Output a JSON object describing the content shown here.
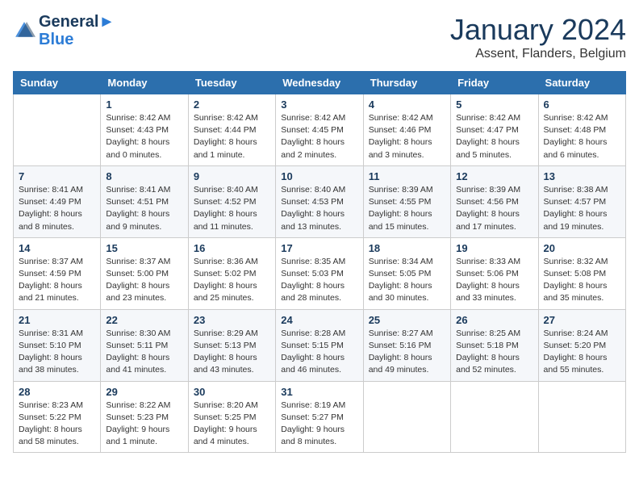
{
  "header": {
    "logo_line1": "General",
    "logo_line2": "Blue",
    "month": "January 2024",
    "location": "Assent, Flanders, Belgium"
  },
  "weekdays": [
    "Sunday",
    "Monday",
    "Tuesday",
    "Wednesday",
    "Thursday",
    "Friday",
    "Saturday"
  ],
  "weeks": [
    [
      {
        "day": "",
        "info": ""
      },
      {
        "day": "1",
        "info": "Sunrise: 8:42 AM\nSunset: 4:43 PM\nDaylight: 8 hours\nand 0 minutes."
      },
      {
        "day": "2",
        "info": "Sunrise: 8:42 AM\nSunset: 4:44 PM\nDaylight: 8 hours\nand 1 minute."
      },
      {
        "day": "3",
        "info": "Sunrise: 8:42 AM\nSunset: 4:45 PM\nDaylight: 8 hours\nand 2 minutes."
      },
      {
        "day": "4",
        "info": "Sunrise: 8:42 AM\nSunset: 4:46 PM\nDaylight: 8 hours\nand 3 minutes."
      },
      {
        "day": "5",
        "info": "Sunrise: 8:42 AM\nSunset: 4:47 PM\nDaylight: 8 hours\nand 5 minutes."
      },
      {
        "day": "6",
        "info": "Sunrise: 8:42 AM\nSunset: 4:48 PM\nDaylight: 8 hours\nand 6 minutes."
      }
    ],
    [
      {
        "day": "7",
        "info": "Sunrise: 8:41 AM\nSunset: 4:49 PM\nDaylight: 8 hours\nand 8 minutes."
      },
      {
        "day": "8",
        "info": "Sunrise: 8:41 AM\nSunset: 4:51 PM\nDaylight: 8 hours\nand 9 minutes."
      },
      {
        "day": "9",
        "info": "Sunrise: 8:40 AM\nSunset: 4:52 PM\nDaylight: 8 hours\nand 11 minutes."
      },
      {
        "day": "10",
        "info": "Sunrise: 8:40 AM\nSunset: 4:53 PM\nDaylight: 8 hours\nand 13 minutes."
      },
      {
        "day": "11",
        "info": "Sunrise: 8:39 AM\nSunset: 4:55 PM\nDaylight: 8 hours\nand 15 minutes."
      },
      {
        "day": "12",
        "info": "Sunrise: 8:39 AM\nSunset: 4:56 PM\nDaylight: 8 hours\nand 17 minutes."
      },
      {
        "day": "13",
        "info": "Sunrise: 8:38 AM\nSunset: 4:57 PM\nDaylight: 8 hours\nand 19 minutes."
      }
    ],
    [
      {
        "day": "14",
        "info": "Sunrise: 8:37 AM\nSunset: 4:59 PM\nDaylight: 8 hours\nand 21 minutes."
      },
      {
        "day": "15",
        "info": "Sunrise: 8:37 AM\nSunset: 5:00 PM\nDaylight: 8 hours\nand 23 minutes."
      },
      {
        "day": "16",
        "info": "Sunrise: 8:36 AM\nSunset: 5:02 PM\nDaylight: 8 hours\nand 25 minutes."
      },
      {
        "day": "17",
        "info": "Sunrise: 8:35 AM\nSunset: 5:03 PM\nDaylight: 8 hours\nand 28 minutes."
      },
      {
        "day": "18",
        "info": "Sunrise: 8:34 AM\nSunset: 5:05 PM\nDaylight: 8 hours\nand 30 minutes."
      },
      {
        "day": "19",
        "info": "Sunrise: 8:33 AM\nSunset: 5:06 PM\nDaylight: 8 hours\nand 33 minutes."
      },
      {
        "day": "20",
        "info": "Sunrise: 8:32 AM\nSunset: 5:08 PM\nDaylight: 8 hours\nand 35 minutes."
      }
    ],
    [
      {
        "day": "21",
        "info": "Sunrise: 8:31 AM\nSunset: 5:10 PM\nDaylight: 8 hours\nand 38 minutes."
      },
      {
        "day": "22",
        "info": "Sunrise: 8:30 AM\nSunset: 5:11 PM\nDaylight: 8 hours\nand 41 minutes."
      },
      {
        "day": "23",
        "info": "Sunrise: 8:29 AM\nSunset: 5:13 PM\nDaylight: 8 hours\nand 43 minutes."
      },
      {
        "day": "24",
        "info": "Sunrise: 8:28 AM\nSunset: 5:15 PM\nDaylight: 8 hours\nand 46 minutes."
      },
      {
        "day": "25",
        "info": "Sunrise: 8:27 AM\nSunset: 5:16 PM\nDaylight: 8 hours\nand 49 minutes."
      },
      {
        "day": "26",
        "info": "Sunrise: 8:25 AM\nSunset: 5:18 PM\nDaylight: 8 hours\nand 52 minutes."
      },
      {
        "day": "27",
        "info": "Sunrise: 8:24 AM\nSunset: 5:20 PM\nDaylight: 8 hours\nand 55 minutes."
      }
    ],
    [
      {
        "day": "28",
        "info": "Sunrise: 8:23 AM\nSunset: 5:22 PM\nDaylight: 8 hours\nand 58 minutes."
      },
      {
        "day": "29",
        "info": "Sunrise: 8:22 AM\nSunset: 5:23 PM\nDaylight: 9 hours\nand 1 minute."
      },
      {
        "day": "30",
        "info": "Sunrise: 8:20 AM\nSunset: 5:25 PM\nDaylight: 9 hours\nand 4 minutes."
      },
      {
        "day": "31",
        "info": "Sunrise: 8:19 AM\nSunset: 5:27 PM\nDaylight: 9 hours\nand 8 minutes."
      },
      {
        "day": "",
        "info": ""
      },
      {
        "day": "",
        "info": ""
      },
      {
        "day": "",
        "info": ""
      }
    ]
  ]
}
